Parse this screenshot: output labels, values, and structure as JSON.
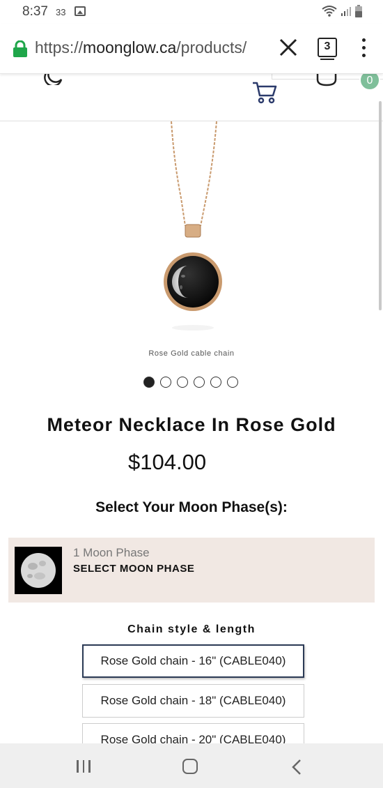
{
  "status_bar": {
    "time": "8:37",
    "notification_count": "33",
    "icons": [
      "image-icon",
      "wifi-icon",
      "signal-icon",
      "battery-icon"
    ]
  },
  "browser": {
    "url_scheme": "https://",
    "url_host": "moonglow.ca",
    "url_path": "/products/",
    "tab_count": "3",
    "icons": [
      "lock-icon",
      "close-icon",
      "tabs-icon",
      "more-vert-icon"
    ]
  },
  "site_header": {
    "cart_count": "0",
    "icons": [
      "moon-logo-icon",
      "cart-icon",
      "account-icon"
    ]
  },
  "product": {
    "image_caption": "Rose Gold cable chain",
    "carousel_total": 6,
    "carousel_active": 1,
    "title": "Meteor Necklace In Rose Gold",
    "price": "$104.00",
    "select_label": "Select Your Moon Phase(s):",
    "phase_card": {
      "count_label": "1 Moon Phase",
      "action_label": "SELECT MOON PHASE"
    },
    "chain_label": "Chain style & length",
    "chain_options": [
      "Rose Gold chain - 16\" (CABLE040)",
      "Rose Gold chain - 18\" (CABLE040)",
      "Rose Gold chain - 20\" (CABLE040)"
    ],
    "chain_selected_index": 0
  },
  "colors": {
    "lock_green": "#1fa64a",
    "cart_navy": "#2b3a6b",
    "badge_green": "#7fbf9a",
    "phase_card_bg": "#f1e8e3",
    "rose_gold": "#c99a6e"
  },
  "nav_bar": {
    "icons": [
      "recents-icon",
      "home-icon",
      "back-icon"
    ]
  }
}
